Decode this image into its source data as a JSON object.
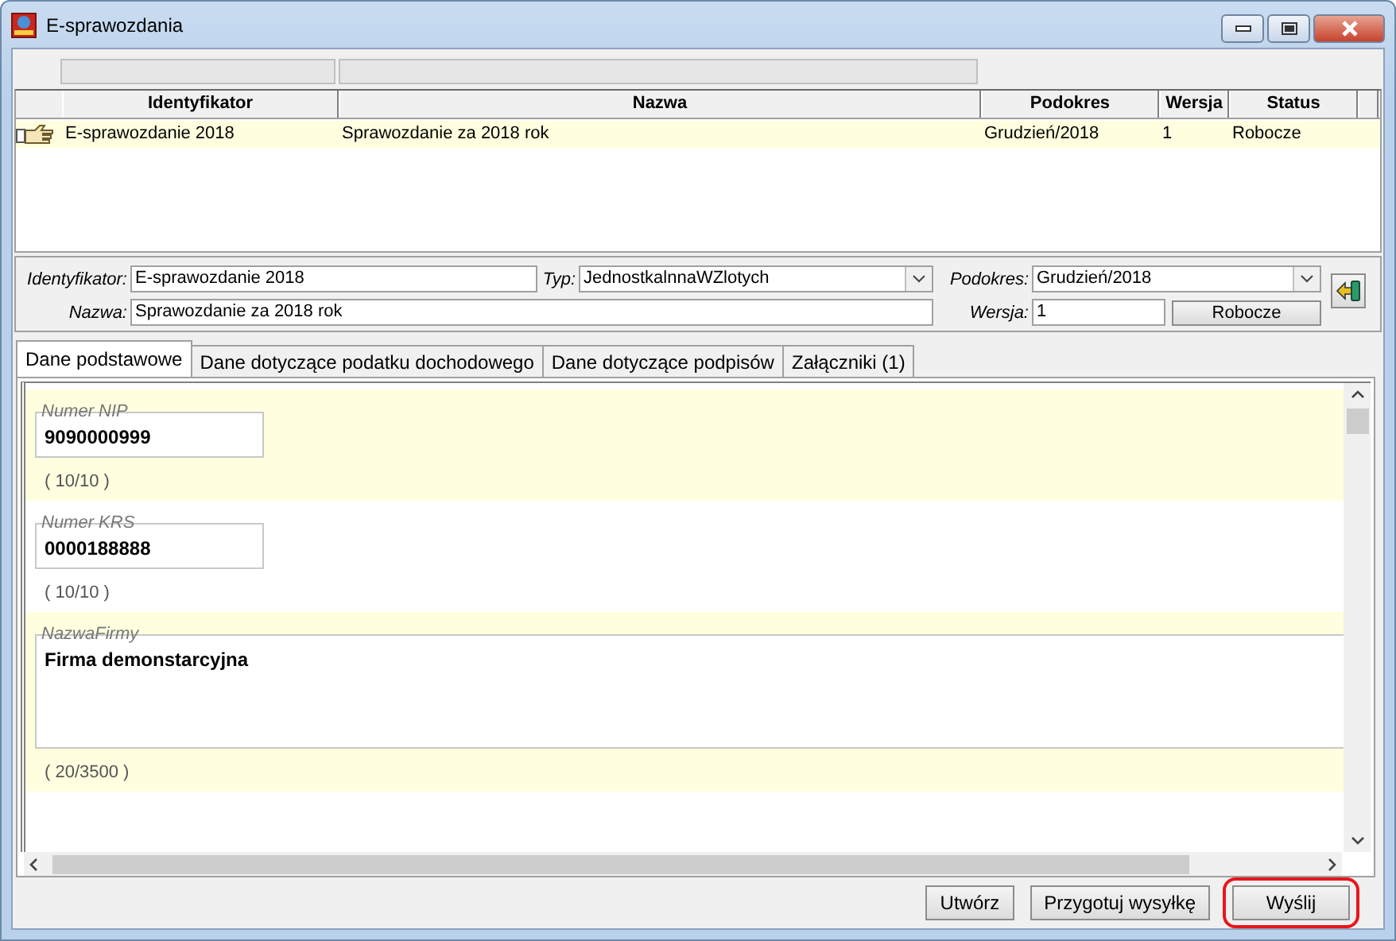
{
  "window": {
    "title": "E-sprawozdania"
  },
  "table": {
    "columns": [
      "Identyfikator",
      "Nazwa",
      "Podokres",
      "Wersja",
      "Status"
    ],
    "rows": [
      {
        "cells": [
          "E-sprawozdanie 2018",
          "Sprawozdanie za 2018 rok",
          "Grudzień/2018",
          "1",
          "Robocze"
        ],
        "selected": true
      }
    ]
  },
  "form": {
    "identyfikator": {
      "label": "Identyfikator:",
      "value": "E-sprawozdanie 2018"
    },
    "typ": {
      "label": "Typ:",
      "value": "JednostkalnnaWZlotych"
    },
    "podokres": {
      "label": "Podokres:",
      "value": "Grudzień/2018"
    },
    "nazwa": {
      "label": "Nazwa:",
      "value": "Sprawozdanie za 2018 rok"
    },
    "wersja": {
      "label": "Wersja:",
      "value": "1"
    },
    "status_button": "Robocze"
  },
  "tabs": [
    {
      "label": "Dane podstawowe",
      "selected": true
    },
    {
      "label": "Dane dotyczące podatku dochodowego",
      "selected": false
    },
    {
      "label": "Dane dotyczące podpisów",
      "selected": false
    },
    {
      "label": "Załączniki (1)",
      "selected": false
    }
  ],
  "fields": [
    {
      "kind": "short",
      "label": "Numer NIP",
      "value": "9090000999",
      "counter": "( 10/10 )"
    },
    {
      "kind": "short",
      "label": "Numer KRS",
      "value": "0000188888",
      "counter": "( 10/10 )"
    },
    {
      "kind": "long",
      "label": "NazwaFirmy",
      "value": "Firma demonstarcyjna",
      "counter": "( 20/3500 )"
    }
  ],
  "buttons": [
    {
      "label": "Utwórz",
      "highlighted": false
    },
    {
      "label": "Przygotuj wysyłkę",
      "highlighted": false
    },
    {
      "label": "Wyślij",
      "highlighted": true
    }
  ]
}
